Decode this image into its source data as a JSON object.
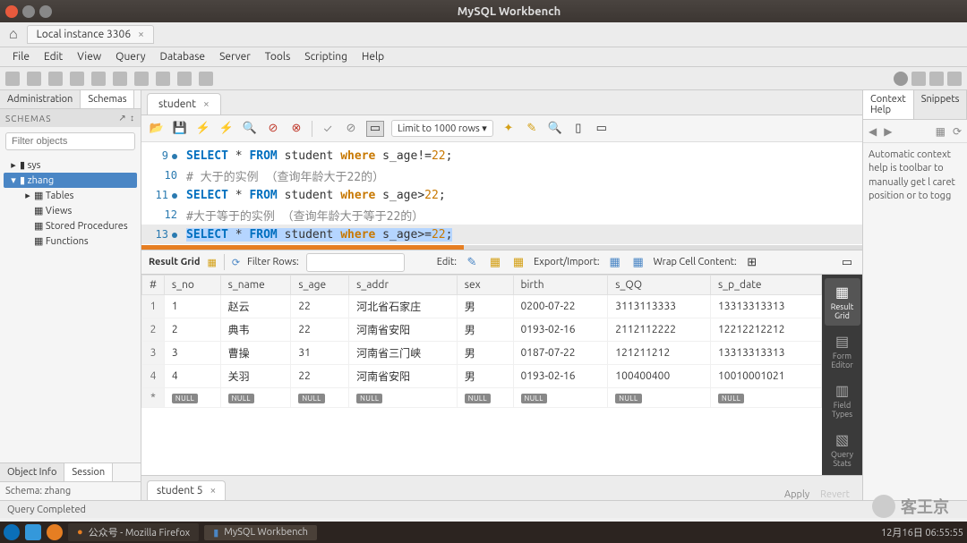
{
  "window": {
    "title": "MySQL Workbench"
  },
  "connection": {
    "tab_label": "Local instance 3306"
  },
  "menu": [
    "File",
    "Edit",
    "View",
    "Query",
    "Database",
    "Server",
    "Tools",
    "Scripting",
    "Help"
  ],
  "left_panel": {
    "tabs": [
      "Administration",
      "Schemas"
    ],
    "schemas_label": "SCHEMAS",
    "filter_placeholder": "Filter objects",
    "tree": {
      "sys": "sys",
      "zhang": "zhang",
      "children": [
        "Tables",
        "Views",
        "Stored Procedures",
        "Functions"
      ]
    },
    "bottom_tabs": [
      "Object Info",
      "Session"
    ],
    "info": "Schema: zhang"
  },
  "editor": {
    "file_tab": "student",
    "limit_label": "Limit to 1000 rows",
    "lines": [
      {
        "num": "9",
        "has_dot": true,
        "type": "sql",
        "seg": [
          "SELECT",
          " * ",
          "FROM",
          " student ",
          "where",
          " s_age!=",
          "22",
          ";"
        ]
      },
      {
        "num": "10",
        "has_dot": false,
        "type": "cmt",
        "text": "# 大于的实例 （查询年龄大于22的）"
      },
      {
        "num": "11",
        "has_dot": true,
        "type": "sql",
        "seg": [
          "SELECT",
          " * ",
          "FROM",
          " student ",
          "where",
          " s_age>",
          "22",
          ";"
        ]
      },
      {
        "num": "12",
        "has_dot": false,
        "type": "cmt",
        "text": "#大于等于的实例 （查询年龄大于等于22的）"
      },
      {
        "num": "13",
        "has_dot": true,
        "type": "sql_sel",
        "seg": [
          "SELECT",
          " * ",
          "FROM",
          " student ",
          "where",
          " s_age>=",
          "22",
          ";"
        ]
      }
    ]
  },
  "result_toolbar": {
    "label": "Result Grid",
    "filter_label": "Filter Rows:",
    "edit_label": "Edit:",
    "export_label": "Export/Import:",
    "wrap_label": "Wrap Cell Content:"
  },
  "grid": {
    "columns": [
      "#",
      "s_no",
      "s_name",
      "s_age",
      "s_addr",
      "sex",
      "birth",
      "s_QQ",
      "s_p_date"
    ],
    "rows": [
      [
        "1",
        "1",
        "赵云",
        "22",
        "河北省石家庄",
        "男",
        "0200-07-22",
        "3113113333",
        "13313313313"
      ],
      [
        "2",
        "2",
        "典韦",
        "22",
        "河南省安阳",
        "男",
        "0193-02-16",
        "2112112222",
        "12212212212"
      ],
      [
        "3",
        "3",
        "曹操",
        "31",
        "河南省三门峡",
        "男",
        "0187-07-22",
        "121211212",
        "13313313313"
      ],
      [
        "4",
        "4",
        "关羽",
        "22",
        "河南省安阳",
        "男",
        "0193-02-16",
        "100400400",
        "10010001021"
      ]
    ],
    "null_label": "NULL"
  },
  "side_tabs": [
    {
      "label": "Result Grid"
    },
    {
      "label": "Form Editor"
    },
    {
      "label": "Field Types"
    },
    {
      "label": "Query Stats"
    }
  ],
  "bottom": {
    "tab": "student 5",
    "apply": "Apply",
    "revert": "Revert"
  },
  "right_panel": {
    "tabs": [
      "Context Help",
      "Snippets"
    ],
    "text": "Automatic context help is toolbar to manually get l caret position or to togg"
  },
  "status": "Query Completed",
  "taskbar": {
    "firefox": "公众号 - Mozilla Firefox",
    "workbench": "MySQL Workbench",
    "clock": "12月16日 06:55:55"
  },
  "watermark": "客王京"
}
